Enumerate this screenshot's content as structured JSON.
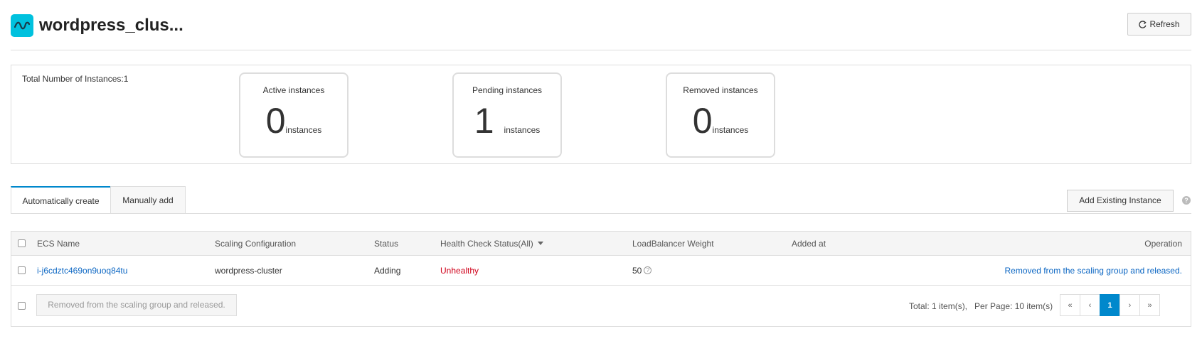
{
  "header": {
    "title": "wordpress_clus...",
    "refresh_label": "Refresh"
  },
  "summary": {
    "total_label": "Total Number of Instances:1",
    "cards": [
      {
        "label": "Active instances",
        "value": "0",
        "unit": "instances"
      },
      {
        "label": "Pending instances",
        "value": "1",
        "unit": "instances"
      },
      {
        "label": "Removed instances",
        "value": "0",
        "unit": "instances"
      }
    ]
  },
  "tabs": [
    {
      "label": "Automatically create",
      "active": true
    },
    {
      "label": "Manually add",
      "active": false
    }
  ],
  "add_existing_label": "Add Existing Instance",
  "help_icon": "?",
  "table": {
    "columns": [
      "ECS Name",
      "Scaling Configuration",
      "Status",
      "Health Check Status(All)",
      "LoadBalancer Weight",
      "Added at",
      "Operation"
    ],
    "rows": [
      {
        "ecs_name": "i-j6cdztc469on9uoq84tu",
        "scaling_configuration": "wordpress-cluster",
        "status": "Adding",
        "health": "Unhealthy",
        "weight": "50",
        "added_at": "",
        "operation": "Removed from the scaling group and released."
      }
    ],
    "bulk_action_label": "Removed from the scaling group and released.",
    "total_text": "Total: 1 item(s),",
    "per_page_text": "Per Page: 10 item(s)",
    "pager": {
      "first": "«",
      "prev": "‹",
      "current": "1",
      "next": "›",
      "last": "»"
    }
  },
  "colors": {
    "accent": "#0088cc",
    "link": "#0b66c3",
    "error": "#d0021b",
    "logo": "#00c1de"
  }
}
